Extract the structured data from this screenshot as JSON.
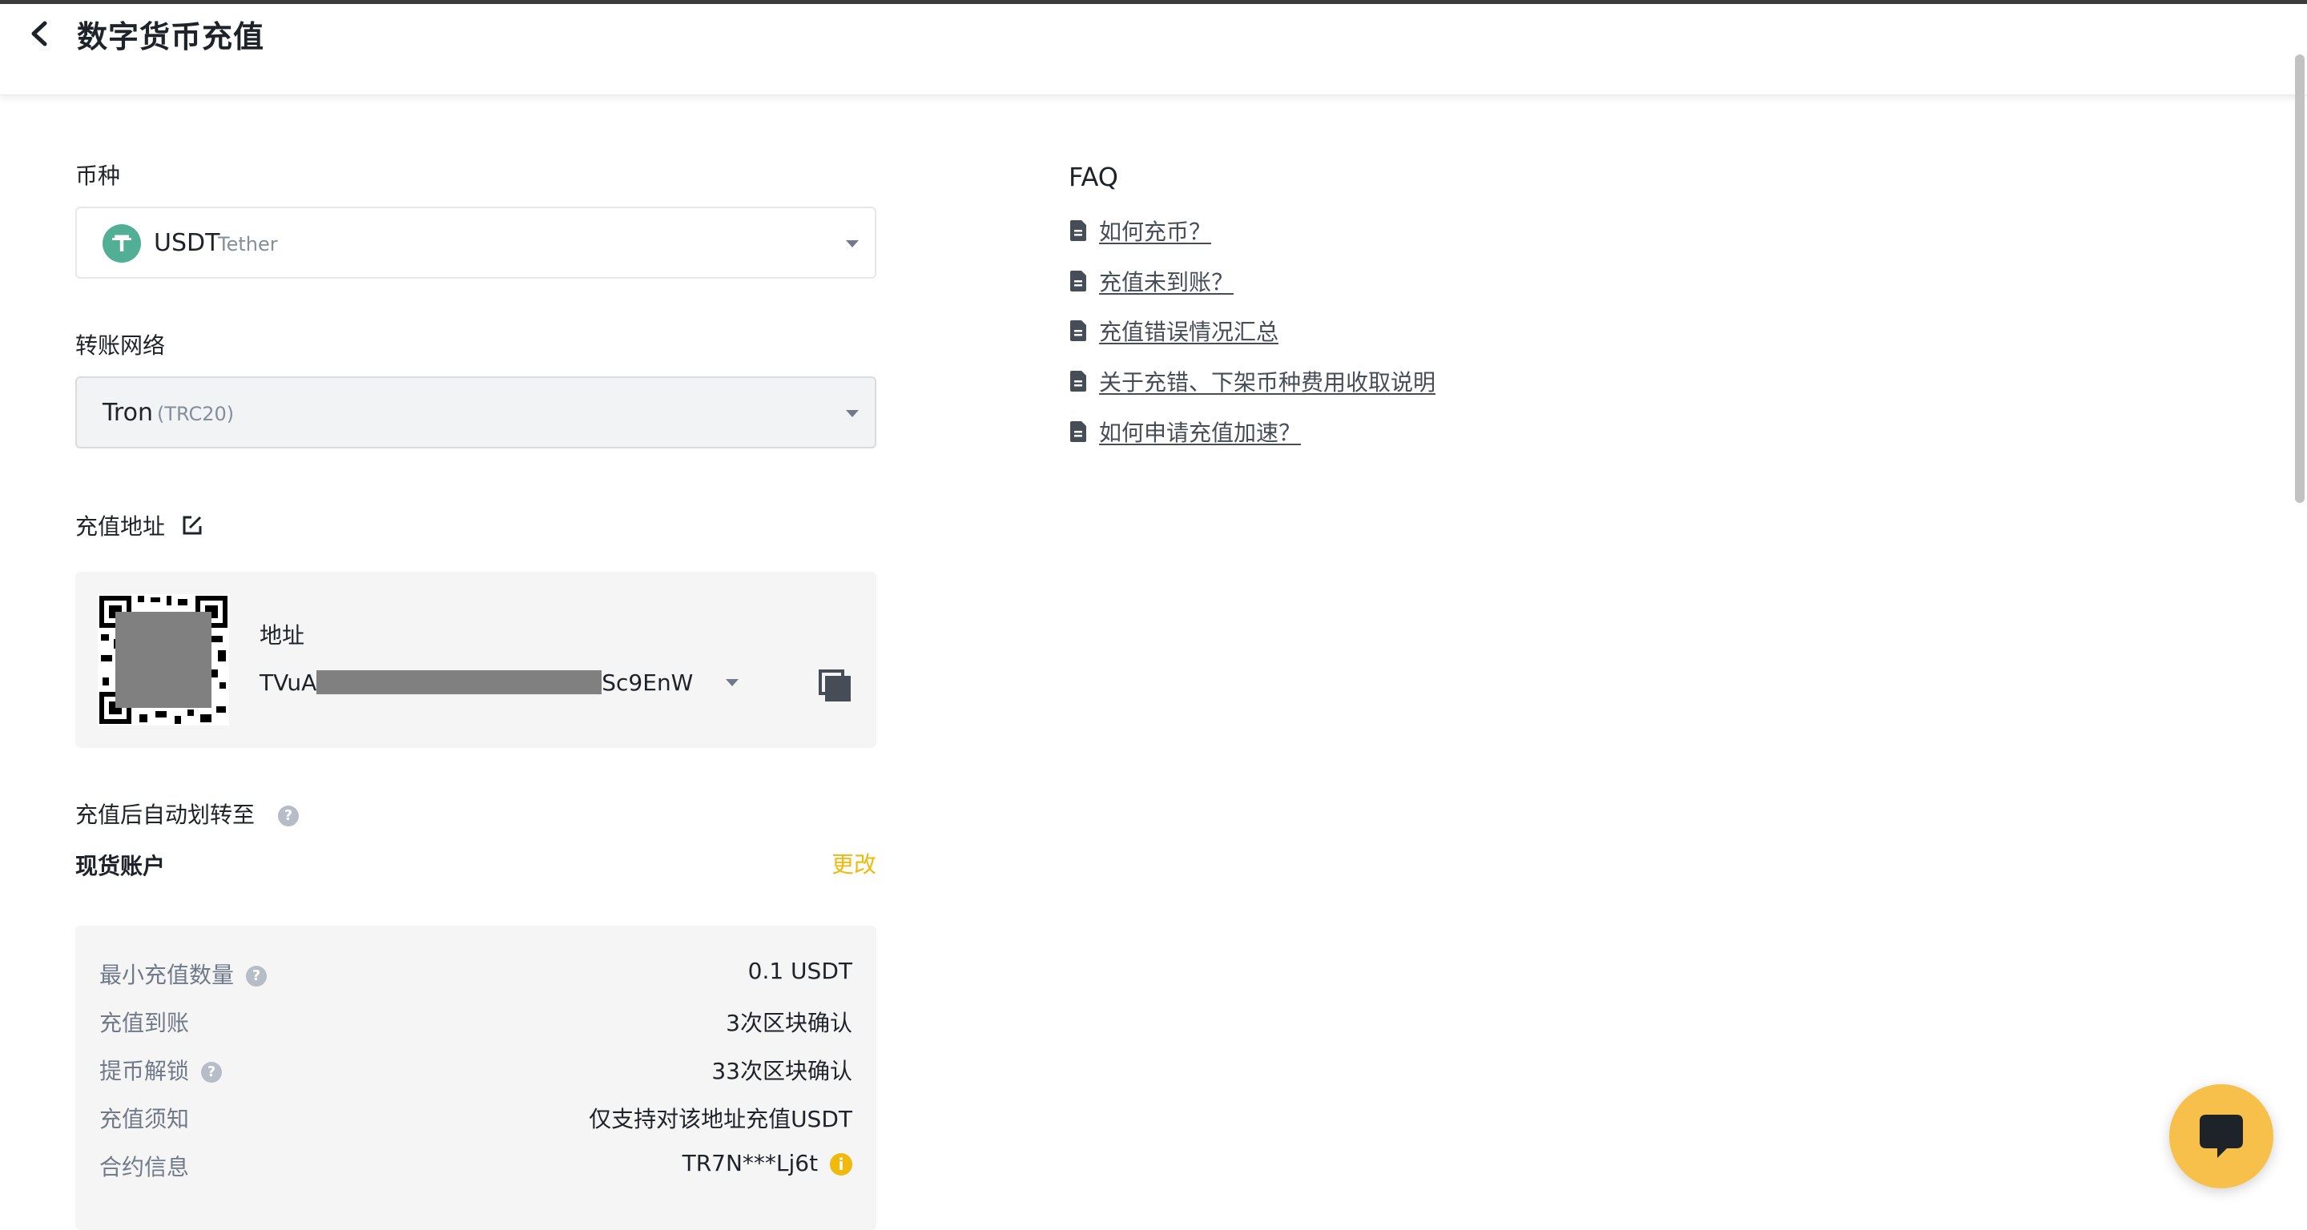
{
  "header": {
    "title": "数字货币充值"
  },
  "coin": {
    "label": "币种",
    "symbol": "USDT",
    "name": "Tether",
    "icon_letter": "T",
    "icon_color": "#50af95"
  },
  "network": {
    "label": "转账网络",
    "name": "Tron",
    "standard": "(TRC20)"
  },
  "deposit_address": {
    "label": "充值地址",
    "card_title": "地址",
    "prefix": "TVuA",
    "suffix": "Sc9EnW"
  },
  "auto_transfer": {
    "label": "充值后自动划转至",
    "account": "现货账户",
    "change_label": "更改"
  },
  "info": {
    "rows": [
      {
        "key": "最小充值数量",
        "value": "0.1 USDT",
        "has_help": true
      },
      {
        "key": "充值到账",
        "value": "3次区块确认",
        "has_help": false
      },
      {
        "key": "提币解锁",
        "value": "33次区块确认",
        "has_help": true
      },
      {
        "key": "充值须知",
        "value": "仅支持对该地址充值USDT",
        "has_help": false
      },
      {
        "key": "合约信息",
        "value": "TR7N***Lj6t",
        "has_help": false
      }
    ]
  },
  "faq": {
    "title": "FAQ",
    "items": [
      "如何充币？",
      "充值未到账？",
      "充值错误情况汇总",
      "关于充错、下架币种费用收取说明",
      "如何申请充值加速？"
    ]
  },
  "colors": {
    "accent": "#f0b90b",
    "chat_button": "#f7c04a"
  }
}
